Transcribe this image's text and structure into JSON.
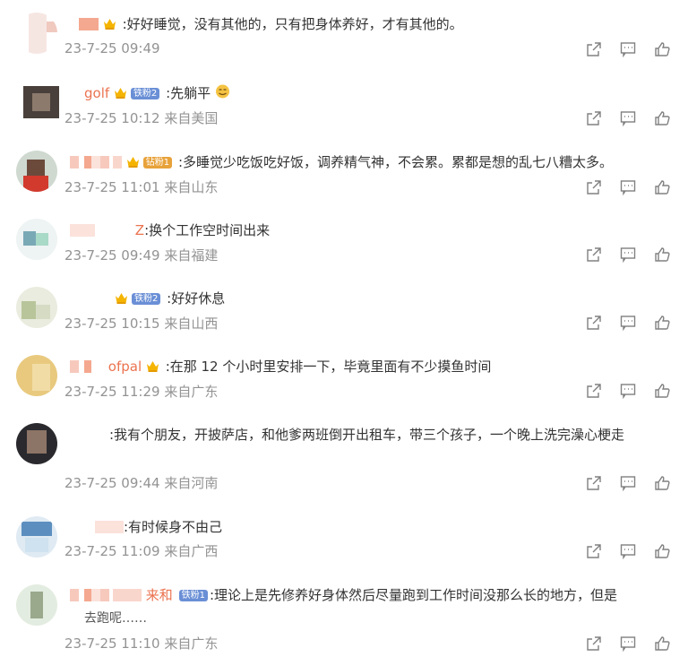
{
  "comments": [
    {
      "name": "",
      "badge": "",
      "text": ":好好睡觉，没有其他的，只有把身体养好，才有其他的。",
      "text2": "",
      "time": "23-7-25 09:49",
      "location": ""
    },
    {
      "name": "golf",
      "badge": "铁粉2",
      "text": ":先躺平",
      "text2": "",
      "time": "23-7-25 10:12",
      "location": "来自美国"
    },
    {
      "name": "",
      "badge": "钻粉1",
      "text": ":多睡觉少吃饭吃好饭，调养精气神，不会累。累都是想的乱七八糟太多。",
      "text2": "",
      "time": "23-7-25 11:01",
      "location": "来自山东"
    },
    {
      "name": "Z",
      "badge": "",
      "text": ":换个工作空时间出来",
      "text2": "",
      "time": "23-7-25 09:49",
      "location": "来自福建"
    },
    {
      "name": "",
      "badge": "铁粉2",
      "text": ":好好休息",
      "text2": "",
      "time": "23-7-25 10:15",
      "location": "来自山西"
    },
    {
      "name": "ofpal",
      "badge": "",
      "text": ":在那 12 个小时里安排一下，毕竟里面有不少摸鱼时间",
      "text2": "",
      "time": "23-7-25 11:29",
      "location": "来自广东"
    },
    {
      "name": "",
      "badge": "",
      "text": ":我有个朋友，开披萨店，和他爹两班倒开出租车，带三个孩子，一个晚上洗完澡心梗走",
      "text2": "",
      "time": "23-7-25 09:44",
      "location": "来自河南"
    },
    {
      "name": "",
      "badge": "",
      "text": ":有时候身不由己",
      "text2": "",
      "time": "23-7-25 11:09",
      "location": "来自广西"
    },
    {
      "name": "来和",
      "badge": "铁粉1",
      "text": ":理论上是先修养好身体然后尽量跑到工作时间没那么长的地方，但是",
      "text2": "去跑呢……",
      "time": "23-7-25 11:10",
      "location": "来自广东"
    }
  ],
  "icons": {
    "share": "share-icon",
    "comment": "comment-icon",
    "like": "like-icon"
  },
  "colors": {
    "name": "#eb7350",
    "meta": "#939393",
    "badge": "#6a8fd6"
  }
}
